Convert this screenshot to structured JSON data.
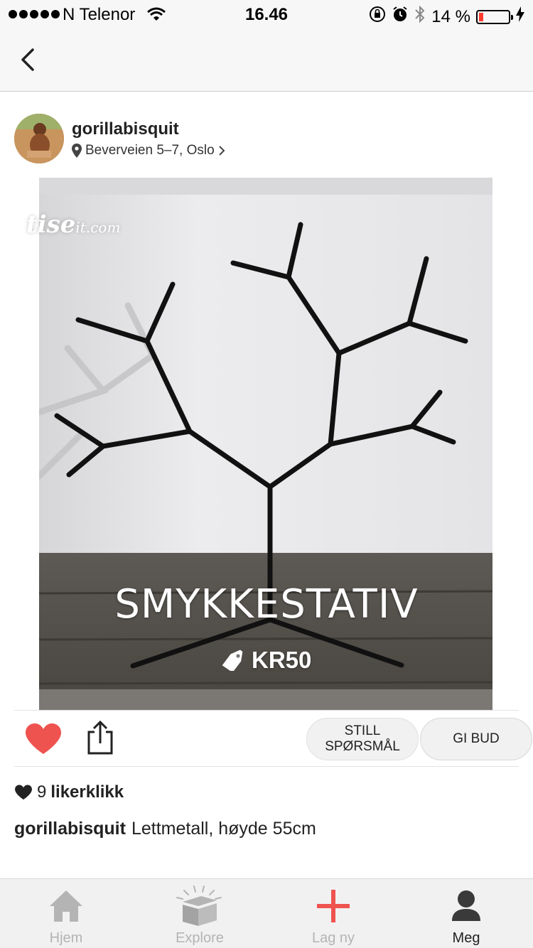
{
  "status_bar": {
    "carrier": "N Telenor",
    "time": "16.46",
    "battery_text": "14 %",
    "battery_level": 0.14
  },
  "post": {
    "username": "gorillabisquit",
    "location": "Beverveien 5–7, Oslo",
    "image": {
      "watermark": "tise",
      "watermark_suffix": "it.com",
      "title": "SMYKKESTATIV",
      "price": "KR50"
    },
    "actions": {
      "ask_label_line1": "STILL",
      "ask_label_line2": "SPØRSMÅL",
      "bid_label": "GI BUD"
    },
    "likes_count": "9",
    "likes_label": "likerklikk",
    "caption_user": "gorillabisquit",
    "caption_text": "Lettmetall, høyde 55cm"
  },
  "tabs": [
    {
      "label": "Hjem",
      "icon": "home-icon",
      "active": false
    },
    {
      "label": "Explore",
      "icon": "treasure-chest-icon",
      "active": false
    },
    {
      "label": "Lag ny",
      "icon": "plus-icon",
      "active": false
    },
    {
      "label": "Meg",
      "icon": "person-icon",
      "active": true
    }
  ],
  "colors": {
    "heart": "#ef5350",
    "plus": "#ef5350",
    "battery_low": "#ff3b30"
  }
}
